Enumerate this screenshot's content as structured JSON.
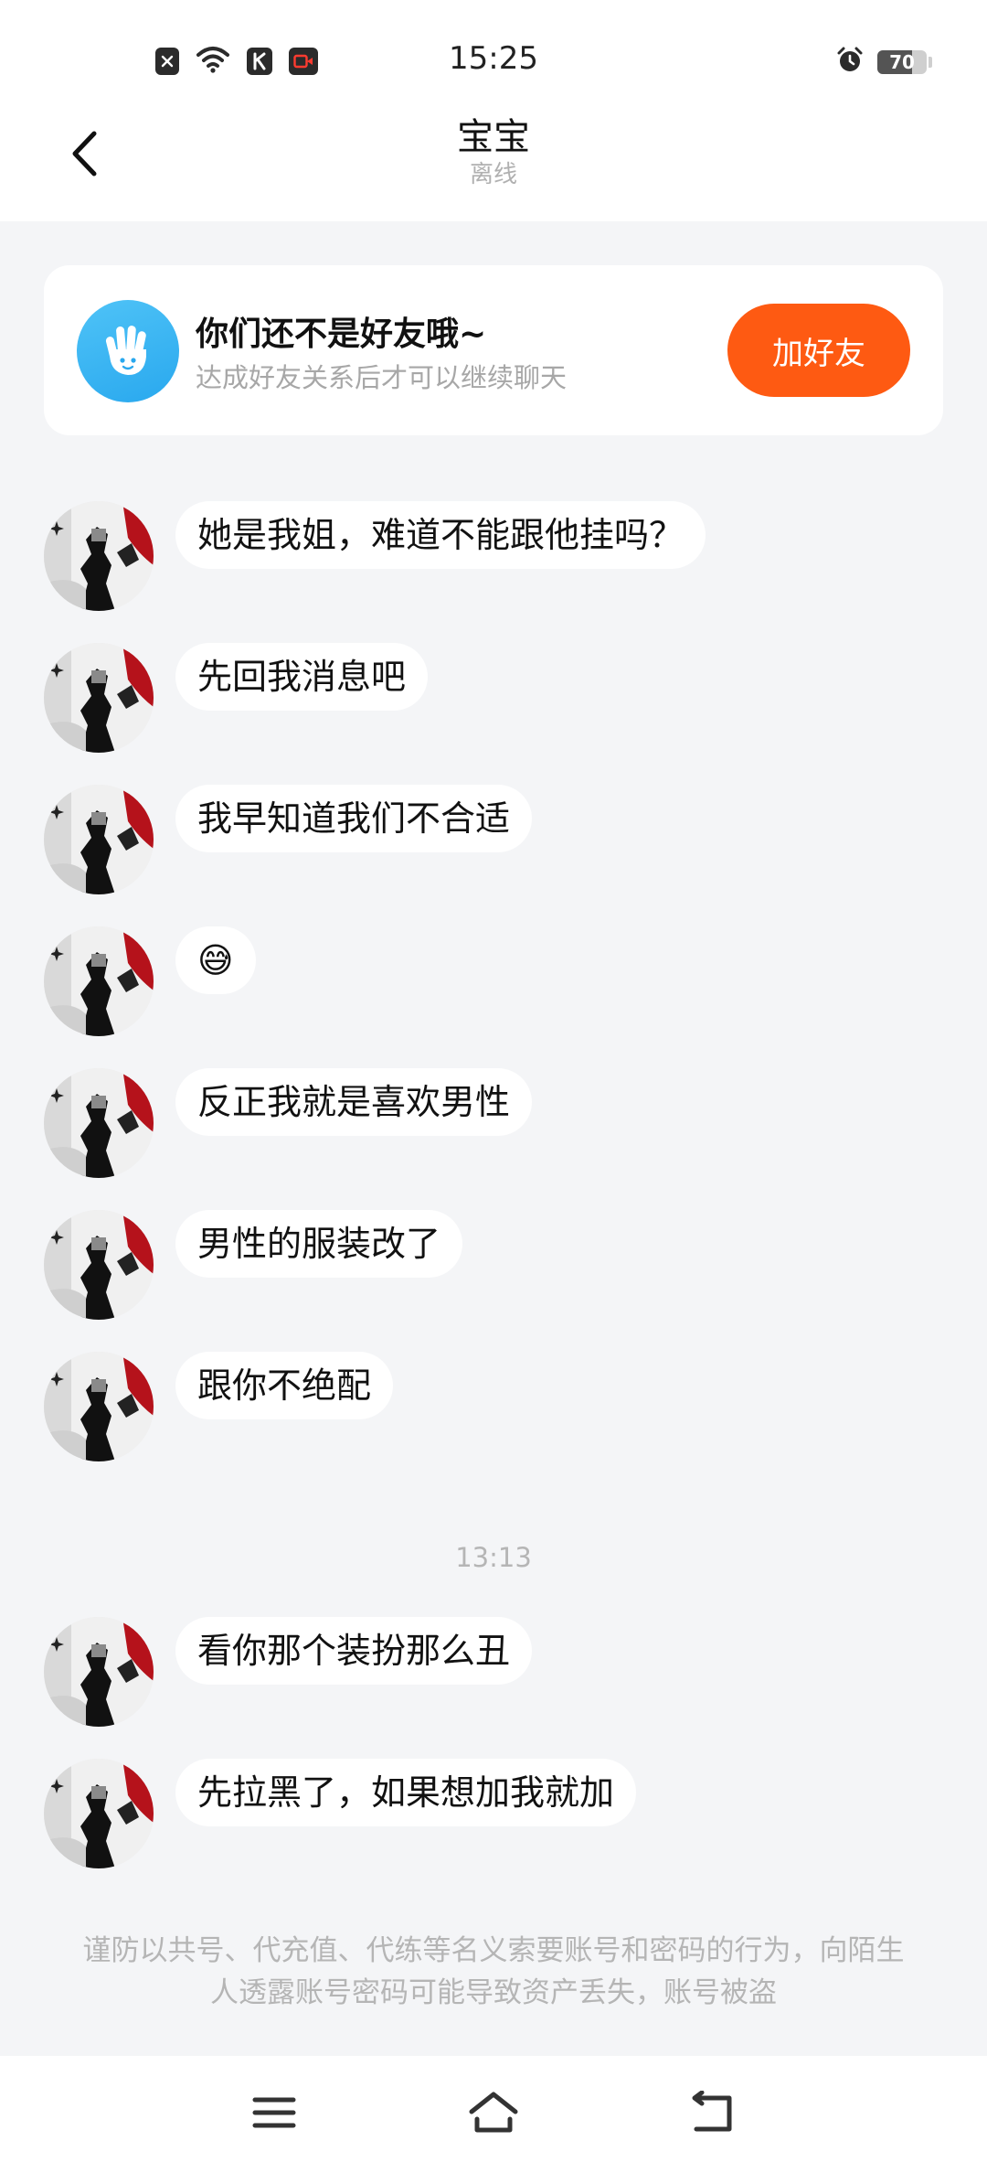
{
  "status_bar": {
    "time": "15:25",
    "battery": "70",
    "battery_level": 0.7,
    "left_icons": [
      "sim-off-icon",
      "wifi-icon",
      "k-app-icon",
      "screen-record-icon"
    ],
    "right_icons": [
      "alarm-icon",
      "battery-icon"
    ]
  },
  "header": {
    "title": "宝宝",
    "subtitle": "离线",
    "back_icon": "chevron-left-icon"
  },
  "friend_card": {
    "title": "你们还不是好友哦~",
    "subtitle": "达成好友关系后才可以继续聊天",
    "button_label": "加好友",
    "button_color": "#fe5a12",
    "icon": "hand-wave-icon",
    "icon_color": "#36b3f3"
  },
  "messages": [
    {
      "text": "她是我姐，难道不能跟他挂吗？"
    },
    {
      "text": "先回我消息吧"
    },
    {
      "text": "我早知道我们不合适"
    },
    {
      "text": "😅"
    },
    {
      "text": "反正我就是喜欢男性"
    },
    {
      "text": "男性的服装改了"
    },
    {
      "text": "跟你不绝配"
    },
    {
      "text": "看你那个装扮那么丑"
    },
    {
      "text": "先拉黑了，如果想加我就加"
    }
  ],
  "timestamp": "13:13",
  "warning": "谨防以共号、代充值、代练等名义索要账号和密码的行为，向陌生人透露账号密码可能导致资产丢失，账号被盗",
  "navbar": {
    "icons": [
      "menu-icon",
      "home-icon",
      "back-nav-icon"
    ]
  },
  "colors": {
    "background": "#f4f5f7",
    "bubble": "#ffffff",
    "accent": "#fe5a12"
  }
}
